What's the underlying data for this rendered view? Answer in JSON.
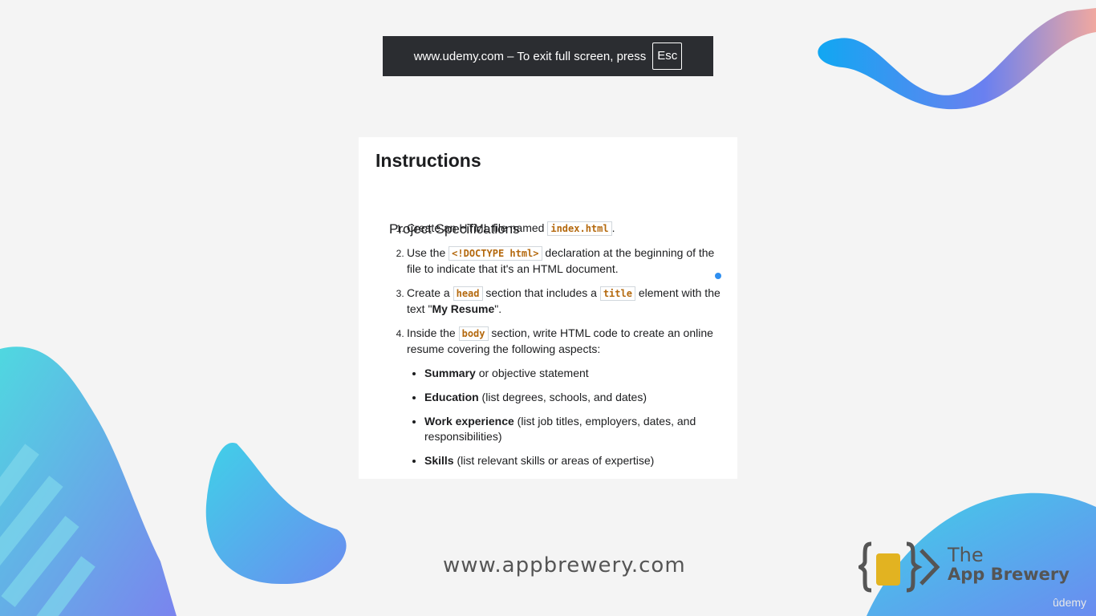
{
  "banner": {
    "text": "www.udemy.com – To exit full screen, press",
    "key": "Esc"
  },
  "instructions": {
    "title": "Instructions",
    "subtitle": "Project Specifications",
    "steps": [
      {
        "pre": "Create an HTML file named ",
        "code": "index.html",
        "post": "."
      },
      {
        "pre": "Use the ",
        "code": "<!DOCTYPE html>",
        "post": " declaration at the beginning of the file to indicate that it's an HTML document."
      },
      {
        "pre": "Create a ",
        "code1": "head",
        "mid": " section that includes a ",
        "code2": "title",
        "post": " element with the text \"",
        "bold": "My Resume",
        "post2": "\"."
      },
      {
        "pre": "Inside the ",
        "code": "body",
        "post": " section, write HTML code to create an online resume covering the following aspects:"
      }
    ],
    "aspects": [
      {
        "bold": "Summary",
        "text": " or objective statement"
      },
      {
        "bold": "Education",
        "text": " (list degrees, schools, and dates)"
      },
      {
        "bold": "Work experience",
        "text": " (list job titles, employers, dates, and responsibilities)"
      },
      {
        "bold": "Skills",
        "text": " (list relevant skills or areas of expertise)"
      }
    ]
  },
  "footer": {
    "url": "www.appbrewery.com"
  },
  "logo": {
    "line1": "The",
    "line2": "App Brewery"
  },
  "watermark": "ûdemy",
  "colors": {
    "accent_dot": "#2f8ff0",
    "code_text": "#b4690e",
    "banner_bg": "#2b2d31"
  }
}
